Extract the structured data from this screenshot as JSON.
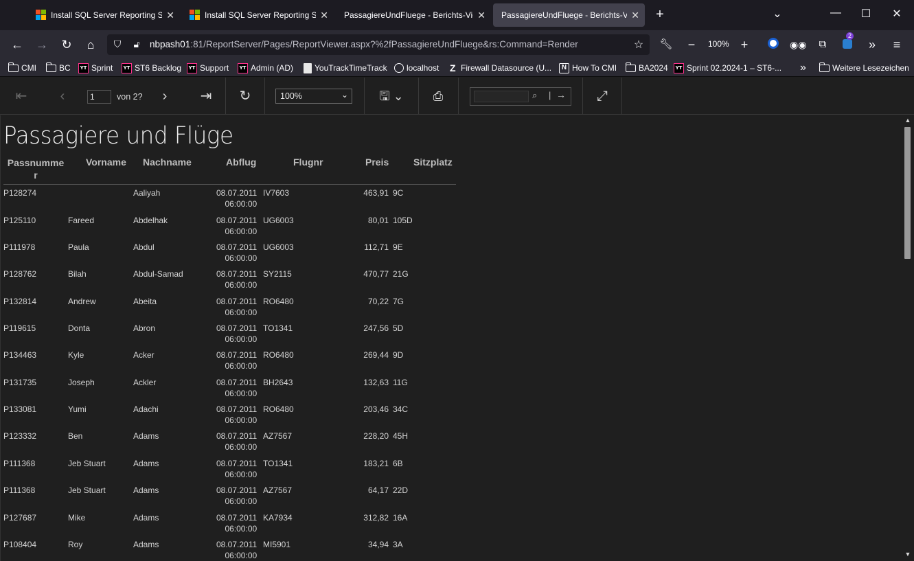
{
  "browser": {
    "tabs": [
      {
        "label": "Install SQL Server Reporting Services",
        "close": "✕",
        "favicon": "microsoft-logo"
      },
      {
        "label": "Install SQL Server Reporting Services",
        "close": "✕",
        "favicon": "microsoft-logo"
      },
      {
        "label": "PassagiereUndFluege - Berichts-Viewer",
        "close": "✕",
        "favicon": "none"
      },
      {
        "label": "PassagiereUndFluege - Berichts-Viewer",
        "close": "✕",
        "favicon": "none"
      }
    ],
    "new_tab": "+",
    "url": {
      "host": "nbpash01",
      "rest": ":81/ReportServer/Pages/ReportViewer.aspx?%2fPassagiereUndFluege&rs:Command=Render"
    },
    "zoom": "100%",
    "extensions_badge": "2",
    "bookmarks": [
      {
        "label": "CMI",
        "icon": "folder-icon"
      },
      {
        "label": "BC",
        "icon": "folder-icon"
      },
      {
        "label": "Sprint",
        "icon": "youtrack-icon"
      },
      {
        "label": "ST6 Backlog",
        "icon": "youtrack-icon"
      },
      {
        "label": "Support",
        "icon": "youtrack-icon"
      },
      {
        "label": "Admin (AD)",
        "icon": "youtrack-icon"
      },
      {
        "label": "YouTrackTimeTrack",
        "icon": "document-icon"
      },
      {
        "label": "localhost",
        "icon": "globe-icon"
      },
      {
        "label": "Firewall Datasource (U...",
        "icon": "z-icon"
      },
      {
        "label": "How To CMI",
        "icon": "notion-icon"
      },
      {
        "label": "BA2024",
        "icon": "folder-icon"
      },
      {
        "label": "Sprint 02.2024-1 – ST6-...",
        "icon": "youtrack-icon"
      }
    ],
    "bookmarks_overflow": "»",
    "other_bookmarks": "Weitere Lesezeichen",
    "yt_glyph": "YT"
  },
  "toolbar": {
    "page_current": "1",
    "page_total_label": "von 2?",
    "zoom_value": "100%",
    "search_placeholder": ""
  },
  "report": {
    "title": "Passagiere und Flüge",
    "columns": [
      "Passnumme\nr",
      "Vorname",
      "Nachname",
      "Abflug",
      "Flugnr",
      "Preis",
      "Sitzplatz"
    ],
    "rows": [
      {
        "pass": "P128274",
        "vorname": "",
        "nachname": "Aaliyah",
        "abflug_date": "08.07.2011",
        "abflug_time": "06:00:00",
        "flugnr": "IV7603",
        "preis": "463,91",
        "sitz": "9C"
      },
      {
        "pass": "P125110",
        "vorname": "Fareed",
        "nachname": "Abdelhak",
        "abflug_date": "08.07.2011",
        "abflug_time": "06:00:00",
        "flugnr": "UG6003",
        "preis": "80,01",
        "sitz": "105D"
      },
      {
        "pass": "P111978",
        "vorname": "Paula",
        "nachname": "Abdul",
        "abflug_date": "08.07.2011",
        "abflug_time": "06:00:00",
        "flugnr": "UG6003",
        "preis": "112,71",
        "sitz": "9E"
      },
      {
        "pass": "P128762",
        "vorname": "Bilah",
        "nachname": "Abdul-Samad",
        "abflug_date": "08.07.2011",
        "abflug_time": "06:00:00",
        "flugnr": "SY2115",
        "preis": "470,77",
        "sitz": "21G"
      },
      {
        "pass": "P132814",
        "vorname": "Andrew",
        "nachname": "Abeita",
        "abflug_date": "08.07.2011",
        "abflug_time": "06:00:00",
        "flugnr": "RO6480",
        "preis": "70,22",
        "sitz": "7G"
      },
      {
        "pass": "P119615",
        "vorname": "Donta",
        "nachname": "Abron",
        "abflug_date": "08.07.2011",
        "abflug_time": "06:00:00",
        "flugnr": "TO1341",
        "preis": "247,56",
        "sitz": "5D"
      },
      {
        "pass": "P134463",
        "vorname": "Kyle",
        "nachname": "Acker",
        "abflug_date": "08.07.2011",
        "abflug_time": "06:00:00",
        "flugnr": "RO6480",
        "preis": "269,44",
        "sitz": "9D"
      },
      {
        "pass": "P131735",
        "vorname": "Joseph",
        "nachname": "Ackler",
        "abflug_date": "08.07.2011",
        "abflug_time": "06:00:00",
        "flugnr": "BH2643",
        "preis": "132,63",
        "sitz": "11G"
      },
      {
        "pass": "P133081",
        "vorname": "Yumi",
        "nachname": "Adachi",
        "abflug_date": "08.07.2011",
        "abflug_time": "06:00:00",
        "flugnr": "RO6480",
        "preis": "203,46",
        "sitz": "34C"
      },
      {
        "pass": "P123332",
        "vorname": "Ben",
        "nachname": "Adams",
        "abflug_date": "08.07.2011",
        "abflug_time": "06:00:00",
        "flugnr": "AZ7567",
        "preis": "228,20",
        "sitz": "45H"
      },
      {
        "pass": "P111368",
        "vorname": "Jeb Stuart",
        "nachname": "Adams",
        "abflug_date": "08.07.2011",
        "abflug_time": "06:00:00",
        "flugnr": "TO1341",
        "preis": "183,21",
        "sitz": "6B"
      },
      {
        "pass": "P111368",
        "vorname": "Jeb Stuart",
        "nachname": "Adams",
        "abflug_date": "08.07.2011",
        "abflug_time": "06:00:00",
        "flugnr": "AZ7567",
        "preis": "64,17",
        "sitz": "22D"
      },
      {
        "pass": "P127687",
        "vorname": "Mike",
        "nachname": "Adams",
        "abflug_date": "08.07.2011",
        "abflug_time": "06:00:00",
        "flugnr": "KA7934",
        "preis": "312,82",
        "sitz": "16A"
      },
      {
        "pass": "P108404",
        "vorname": "Roy",
        "nachname": "Adams",
        "abflug_date": "08.07.2011",
        "abflug_time": "06:00:00",
        "flugnr": "MI5901",
        "preis": "34,94",
        "sitz": "3A"
      }
    ]
  },
  "colors": {
    "accent_active_tab": "#42414d",
    "youtrack_pink": "#ff318c"
  }
}
